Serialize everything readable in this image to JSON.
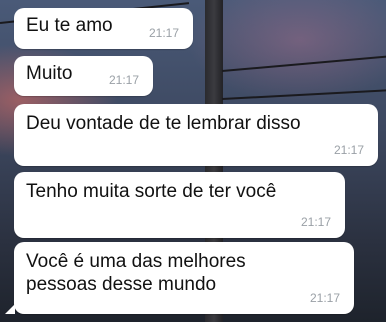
{
  "messages": [
    {
      "text": "Eu te amo",
      "time": "21:17"
    },
    {
      "text": "Muito",
      "time": "21:17"
    },
    {
      "text": "Deu vontade de te lembrar disso",
      "time": "21:17"
    },
    {
      "text": "Tenho muita sorte de ter você",
      "time": "21:17"
    },
    {
      "text_line1": "Você é uma das melhores",
      "text_line2": "pessoas desse mundo",
      "time": "21:17"
    }
  ],
  "colors": {
    "bubble": "#ffffff",
    "timestamp": "#9aa0a6",
    "text": "#111111"
  }
}
